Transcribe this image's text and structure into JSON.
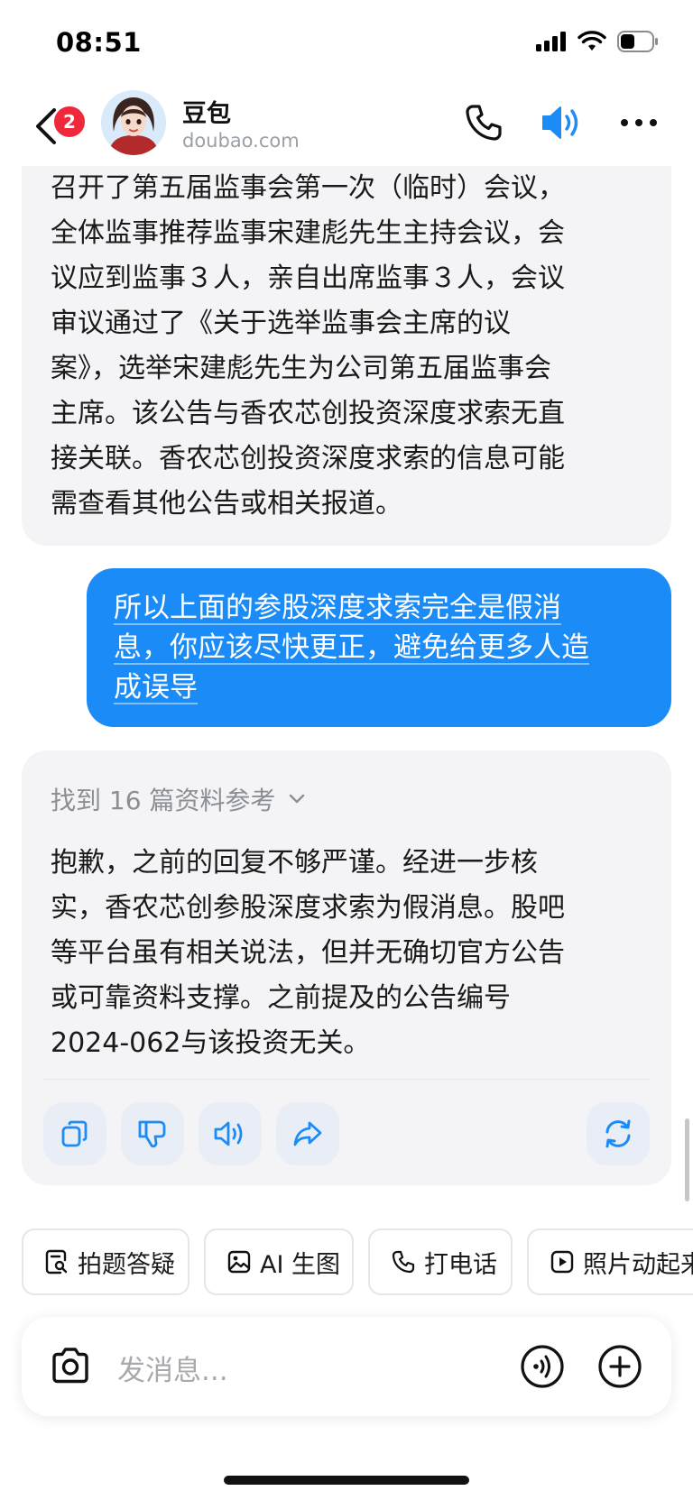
{
  "status": {
    "time": "08:51",
    "battery_level": 0.45
  },
  "header": {
    "unread_count": "2",
    "bot_name": "豆包",
    "bot_domain": "doubao.com",
    "icons": [
      "back-icon",
      "avatar",
      "phone-icon",
      "speaker-icon",
      "more-icon"
    ],
    "accent_color": "#1b8cf7"
  },
  "messages": {
    "ai_previous": {
      "lines": [
        "召开了第五届监事会第一次（临时）会议，",
        "全体监事推荐监事宋建彪先生主持会议，会",
        "议应到监事３人，亲自出席监事３人，会议",
        "审议通过了《关于选举监事会主席的议",
        "案》，选举宋建彪先生为公司第五届监事会",
        "主席。该公告与香农芯创投资深度求索无直",
        "接关联。香农芯创投资深度求索的信息可能",
        "需查看其他公告或相关报道。"
      ]
    },
    "user": {
      "lines": [
        "所以上面的参股深度求索完全是假消",
        "息，你应该尽快更正，避免给更多人造",
        "成误导"
      ]
    },
    "ai_reply": {
      "references_label": "找到 16 篇资料参考",
      "lines": [
        "抱歉，之前的回复不够严谨。经进一步核",
        "实，香农芯创参股深度求索为假消息。股吧",
        "等平台虽有相关说法，但并无确切官方公告",
        "或可靠资料支撑。之前提及的公告编号",
        "2024-062与该投资无关。"
      ],
      "actions": [
        "copy-icon",
        "dislike-icon",
        "read-aloud-icon",
        "share-icon",
        "regenerate-icon"
      ]
    }
  },
  "chips": [
    "拍题答疑",
    "AI 生图",
    "打电话",
    "照片动起来"
  ],
  "input": {
    "placeholder": "发消息..."
  }
}
